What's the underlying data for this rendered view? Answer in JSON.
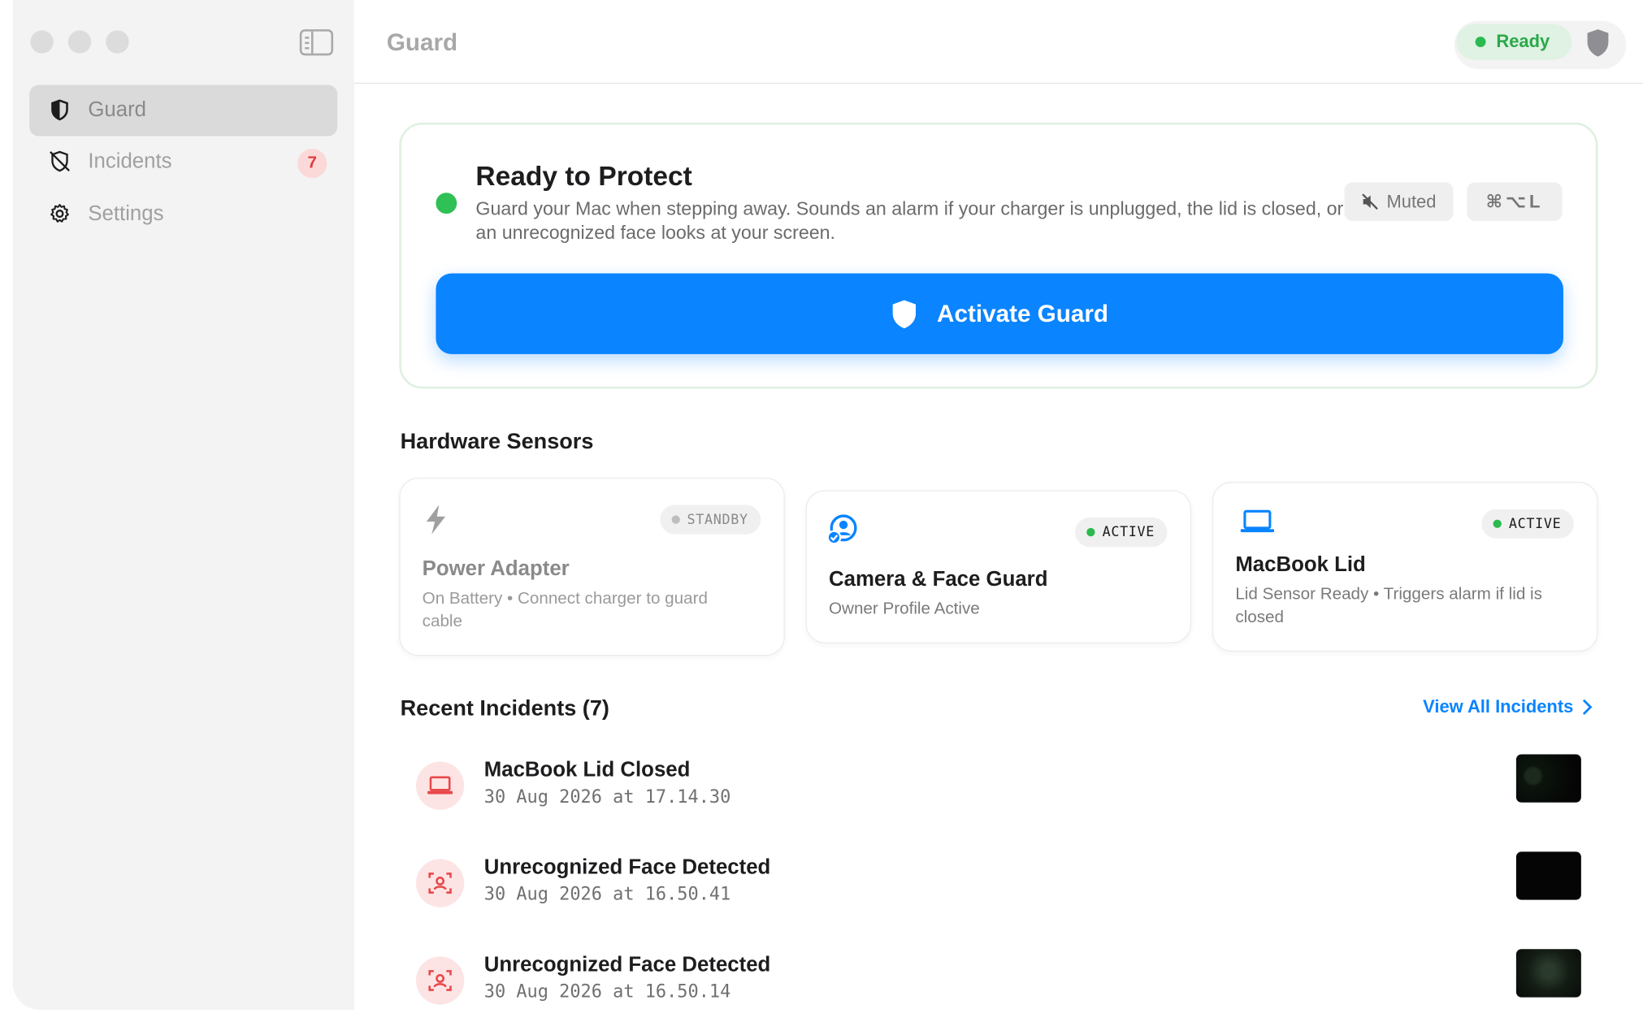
{
  "window": {
    "title": "Guard"
  },
  "sidebar": {
    "items": [
      {
        "label": "Guard",
        "icon": "shield-half-icon",
        "active": true
      },
      {
        "label": "Incidents",
        "icon": "shield-slash-icon",
        "badge": "7"
      },
      {
        "label": "Settings",
        "icon": "gear-icon"
      }
    ]
  },
  "header": {
    "status": "Ready"
  },
  "hero": {
    "title": "Ready to Protect",
    "description": "Guard your Mac when stepping away. Sounds an alarm if your charger is unplugged, the lid is closed, or an unrecognized face looks at your screen.",
    "muted_label": "Muted",
    "shortcut": "⌘⌥L",
    "activate_label": "Activate Guard"
  },
  "sensors": {
    "heading": "Hardware Sensors",
    "items": [
      {
        "name": "Power Adapter",
        "status": "STANDBY",
        "detail": "On Battery • Connect charger to guard cable",
        "icon": "bolt-icon"
      },
      {
        "name": "Camera & Face Guard",
        "status": "ACTIVE",
        "detail": "Owner Profile Active",
        "icon": "face-check-icon"
      },
      {
        "name": "MacBook Lid",
        "status": "ACTIVE",
        "detail": "Lid Sensor Ready • Triggers alarm if lid is closed",
        "icon": "laptop-icon"
      }
    ]
  },
  "incidents": {
    "heading": "Recent Incidents (7)",
    "view_all": "View All Incidents",
    "items": [
      {
        "title": "MacBook Lid Closed",
        "time": "30 Aug 2026 at 17.14.30",
        "icon": "laptop-icon"
      },
      {
        "title": "Unrecognized Face Detected",
        "time": "30 Aug 2026 at 16.50.41",
        "icon": "face-scan-icon"
      },
      {
        "title": "Unrecognized Face Detected",
        "time": "30 Aug 2026 at 16.50.14",
        "icon": "face-scan-icon"
      }
    ]
  },
  "colors": {
    "accent": "#0a84ff",
    "success": "#2cb94f",
    "danger": "#e23c3c"
  }
}
